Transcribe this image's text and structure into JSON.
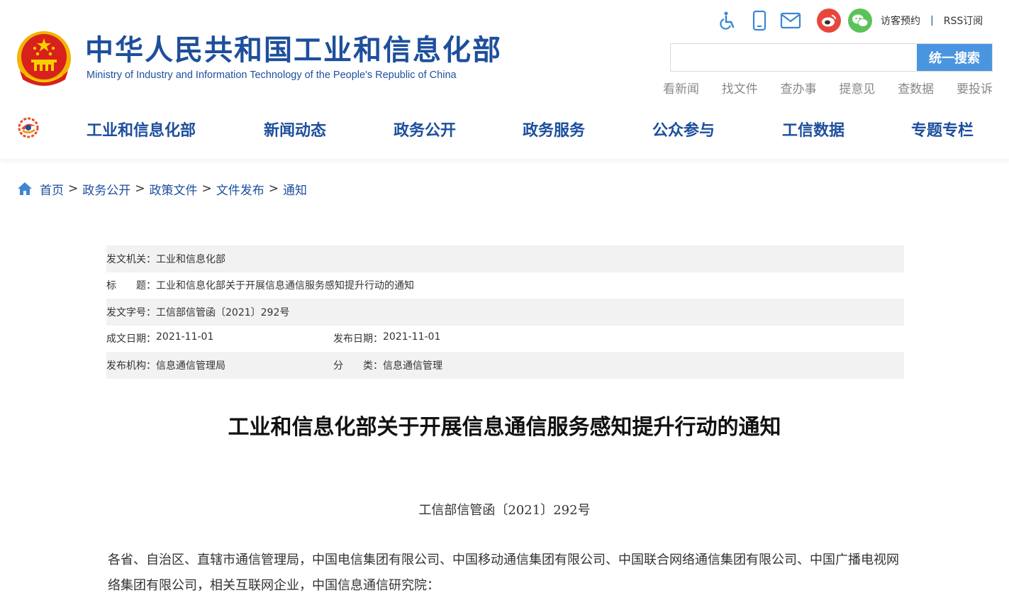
{
  "header": {
    "title": "中华人民共和国工业和信息化部",
    "subtitle": "Ministry of Industry and Information Technology of the People's Republic of China",
    "top_icons": [
      "accessibility-icon",
      "mobile-icon",
      "mail-icon",
      "weibo-icon",
      "wechat-icon"
    ],
    "top_links": {
      "visitor": "访客预约",
      "separator": "|",
      "rss": "RSS订阅"
    },
    "search": {
      "placeholder": "",
      "value": "",
      "button": "统一搜索"
    },
    "quick_links": [
      "看新闻",
      "找文件",
      "查办事",
      "提意见",
      "查数据",
      "要投诉"
    ]
  },
  "nav": {
    "items": [
      "工业和信息化部",
      "新闻动态",
      "政务公开",
      "政务服务",
      "公众参与",
      "工信数据",
      "专题专栏"
    ]
  },
  "breadcrumb": [
    "首页",
    "政务公开",
    "政策文件",
    "文件发布",
    "通知"
  ],
  "breadcrumb_sep": ">",
  "meta": {
    "issuer_label": "发文机关：",
    "issuer": "工业和信息化部",
    "title_label": "标　　题：",
    "title": "工业和信息化部关于开展信息通信服务感知提升行动的通知",
    "doc_no_label": "发文字号：",
    "doc_no": "工信部信管函〔2021〕292号",
    "written_label": "成文日期：",
    "written": "2021-11-01",
    "published_label": "发布日期：",
    "published": "2021-11-01",
    "org_label": "发布机构：",
    "org": "信息通信管理局",
    "category_label": "分　　类：",
    "category": "信息通信管理"
  },
  "article": {
    "title": "工业和信息化部关于开展信息通信服务感知提升行动的通知",
    "doc_no": "工信部信管函〔2021〕292号",
    "body": "各省、自治区、直辖市通信管理局，中国电信集团有限公司、中国移动通信集团有限公司、中国联合网络通信集团有限公司、中国广播电视网络集团有限公司，相关互联网企业，中国信息通信研究院："
  },
  "colors": {
    "brand_blue": "#1d4f9c",
    "search_button": "#4a95e0",
    "weibo": "#e8473c",
    "wechat": "#5bc259",
    "meta_shade": "#f2f2f2"
  }
}
